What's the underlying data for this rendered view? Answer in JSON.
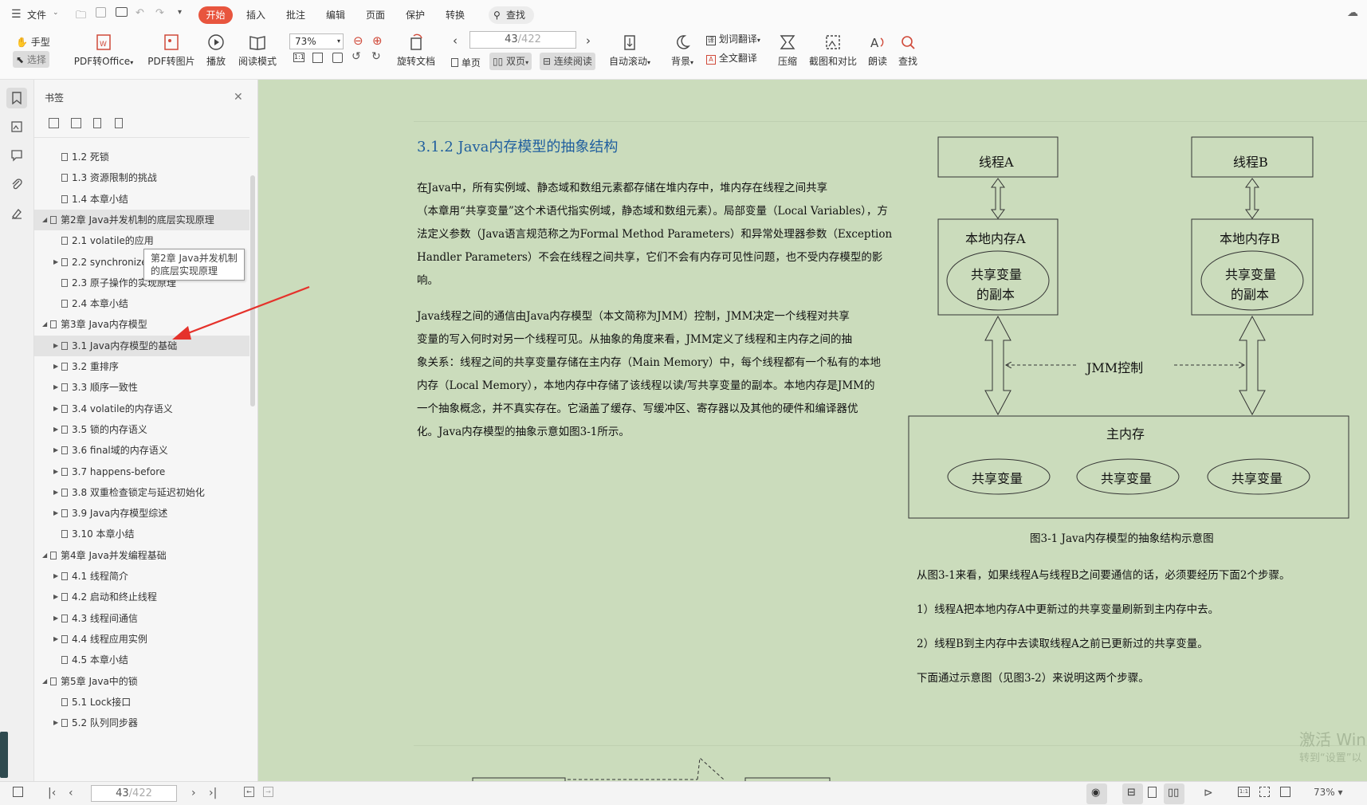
{
  "menubar": {
    "file": "文件",
    "tabs": [
      "开始",
      "插入",
      "批注",
      "编辑",
      "页面",
      "保护",
      "转换"
    ],
    "active_tab": "开始",
    "search": "查找"
  },
  "ribbon": {
    "hand": "手型",
    "select": "选择",
    "pdf_to_office": "PDF转Office",
    "pdf_to_image": "PDF转图片",
    "play": "播放",
    "read_mode": "阅读模式",
    "zoom": "73%",
    "rotate": "旋转文档",
    "page_current": "43",
    "page_total": "/422",
    "single": "单页",
    "double": "双页",
    "continuous": "连续阅读",
    "auto_scroll": "自动滚动",
    "background": "背景",
    "word_translate": "划词翻译",
    "full_translate": "全文翻译",
    "compress": "压缩",
    "screenshot_compare": "截图和对比",
    "read_aloud": "朗读",
    "find": "查找"
  },
  "sidebar": {
    "title": "书签",
    "items": [
      {
        "label": "1.2 死锁",
        "level": 2,
        "arrow": ""
      },
      {
        "label": "1.3 资源限制的挑战",
        "level": 2,
        "arrow": ""
      },
      {
        "label": "1.4 本章小结",
        "level": 2,
        "arrow": ""
      },
      {
        "label": "第2章 Java并发机制的底层实现原理",
        "level": 1,
        "arrow": "◢"
      },
      {
        "label": "2.1 volatile的应用",
        "level": 2,
        "arrow": ""
      },
      {
        "label": "2.2 synchronized的实现原理与应用",
        "level": 2,
        "arrow": "▶"
      },
      {
        "label": "2.3 原子操作的实现原理",
        "level": 2,
        "arrow": ""
      },
      {
        "label": "2.4 本章小结",
        "level": 2,
        "arrow": ""
      },
      {
        "label": "第3章 Java内存模型",
        "level": 1,
        "arrow": "◢"
      },
      {
        "label": "3.1 Java内存模型的基础",
        "level": 2,
        "arrow": "▶"
      },
      {
        "label": "3.2 重排序",
        "level": 2,
        "arrow": "▶"
      },
      {
        "label": "3.3 顺序一致性",
        "level": 2,
        "arrow": "▶"
      },
      {
        "label": "3.4 volatile的内存语义",
        "level": 2,
        "arrow": "▶"
      },
      {
        "label": "3.5 锁的内存语义",
        "level": 2,
        "arrow": "▶"
      },
      {
        "label": "3.6 final域的内存语义",
        "level": 2,
        "arrow": "▶"
      },
      {
        "label": "3.7 happens-before",
        "level": 2,
        "arrow": "▶"
      },
      {
        "label": "3.8 双重检查锁定与延迟初始化",
        "level": 2,
        "arrow": "▶"
      },
      {
        "label": "3.9 Java内存模型综述",
        "level": 2,
        "arrow": "▶"
      },
      {
        "label": "3.10 本章小结",
        "level": 2,
        "arrow": ""
      },
      {
        "label": "第4章 Java并发编程基础",
        "level": 1,
        "arrow": "◢"
      },
      {
        "label": "4.1 线程简介",
        "level": 2,
        "arrow": "▶"
      },
      {
        "label": "4.2 启动和终止线程",
        "level": 2,
        "arrow": "▶"
      },
      {
        "label": "4.3 线程间通信",
        "level": 2,
        "arrow": "▶"
      },
      {
        "label": "4.4 线程应用实例",
        "level": 2,
        "arrow": "▶"
      },
      {
        "label": "4.5 本章小结",
        "level": 2,
        "arrow": ""
      },
      {
        "label": "第5章 Java中的锁",
        "level": 1,
        "arrow": "◢"
      },
      {
        "label": "5.1 Lock接口",
        "level": 2,
        "arrow": ""
      },
      {
        "label": "5.2 队列同步器",
        "level": 2,
        "arrow": "▶"
      }
    ],
    "tooltip": "第2章 Java并发机制的底层实现原理"
  },
  "document": {
    "heading": "3.1.2  Java内存模型的抽象结构",
    "para1": [
      "    在Java中，所有实例域、静态域和数组元素都存储在堆内存中，堆内存在线程之间共享",
      "（本章用“共享变量”这个术语代指实例域，静态域和数组元素）。局部变量（Local Variables），方",
      "法定义参数（Java语言规范称之为Formal Method Parameters）和异常处理器参数（Exception",
      "Handler Parameters）不会在线程之间共享，它们不会有内存可见性问题，也不受内存模型的影",
      "响。"
    ],
    "para2": [
      "    Java线程之间的通信由Java内存模型（本文简称为JMM）控制，JMM决定一个线程对共享",
      "变量的写入何时对另一个线程可见。从抽象的角度来看，JMM定义了线程和主内存之间的抽",
      "象关系：线程之间的共享变量存储在主内存（Main Memory）中，每个线程都有一个私有的本地",
      "内存（Local Memory），本地内存中存储了该线程以读/写共享变量的副本。本地内存是JMM的",
      "一个抽象概念，并不真实存在。它涵盖了缓存、写缓冲区、寄存器以及其他的硬件和编译器优",
      "化。Java内存模型的抽象示意如图3-1所示。"
    ],
    "diagram": {
      "thread_a": "线程A",
      "thread_b": "线程B",
      "local_a": "本地内存A",
      "local_b": "本地内存B",
      "copy_line1": "共享变量",
      "copy_line2": "的副本",
      "jmm": "JMM控制",
      "main": "主内存",
      "shared": "共享变量"
    },
    "caption": "图3-1  Java内存模型的抽象结构示意图",
    "right_text": [
      "从图3-1来看，如果线程A与线程B之间要通信的话，必须要经历下面2个步骤。",
      "1）线程A把本地内存A中更新过的共享变量刷新到主内存中去。",
      "2）线程B到主内存中去读取线程A之前已更新过的共享变量。",
      "下面通过示意图（见图3-2）来说明这两个步骤。"
    ],
    "watermark1": "激活 Win",
    "watermark2": "转到“设置”以"
  },
  "status": {
    "page_current": "43",
    "page_total": "/422",
    "zoom": "73%"
  }
}
